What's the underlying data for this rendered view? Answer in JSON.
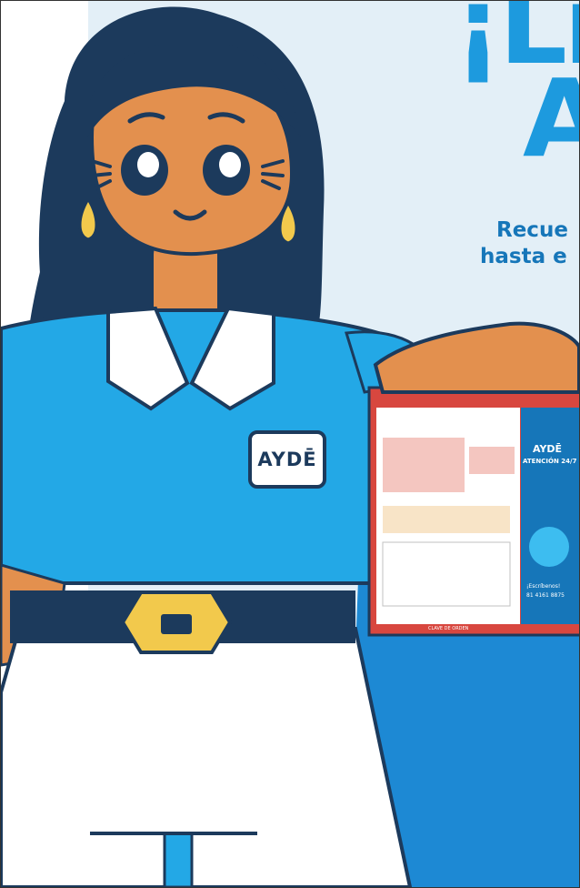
{
  "poster": {
    "headline_line1": "¡Lic",
    "headline_line2": "A",
    "subtitle_line1": "Recue",
    "subtitle_line2": "hasta e",
    "badge_text": "AYDĒ"
  },
  "held_card": {
    "brand": "AYDĒ",
    "service": "ATENCIÓN 24/7",
    "contact_label": "¡Escríbenos!",
    "phone": "81 4161 8875",
    "footer_text": "CLAVE DE ORDEN"
  },
  "colors": {
    "sky_light": "#e3eff7",
    "brand_blue": "#1d9ade",
    "shirt_blue": "#23a8e6",
    "navy": "#1c3a5c",
    "skin": "#e3904e",
    "card_red": "#d8473f",
    "gold": "#f2c94c"
  }
}
